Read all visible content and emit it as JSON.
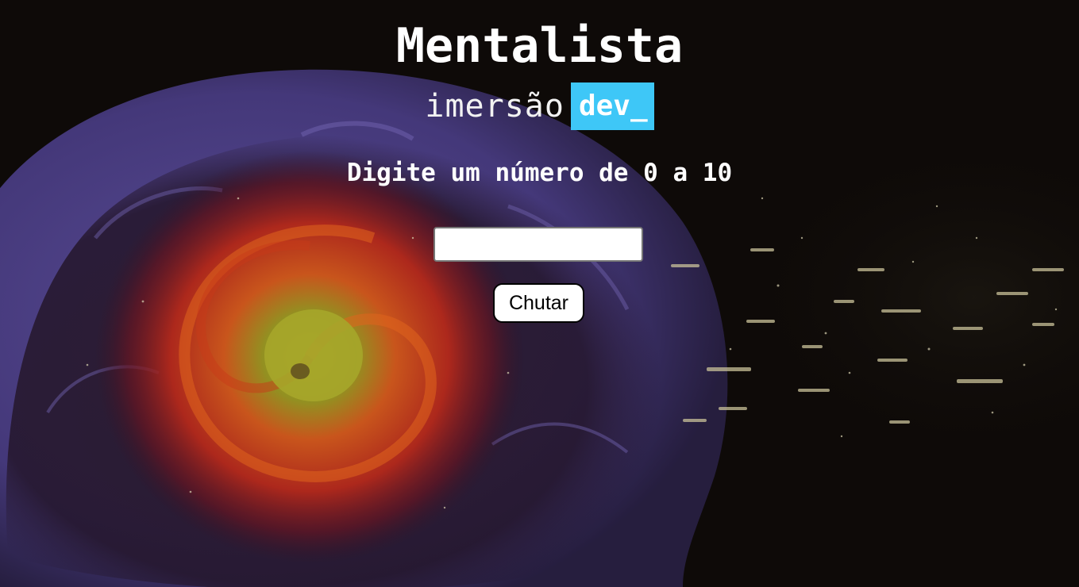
{
  "header": {
    "title": "Mentalista",
    "brand_word": "imersão",
    "brand_tag": "dev_"
  },
  "game": {
    "prompt": "Digite um número de 0 a 10",
    "input_value": "",
    "button_label": "Chutar"
  },
  "colors": {
    "background": "#0d0907",
    "brand_accent": "#3ec7f7",
    "text": "#ffffff"
  },
  "background_image": "brain-nebula-illustration"
}
